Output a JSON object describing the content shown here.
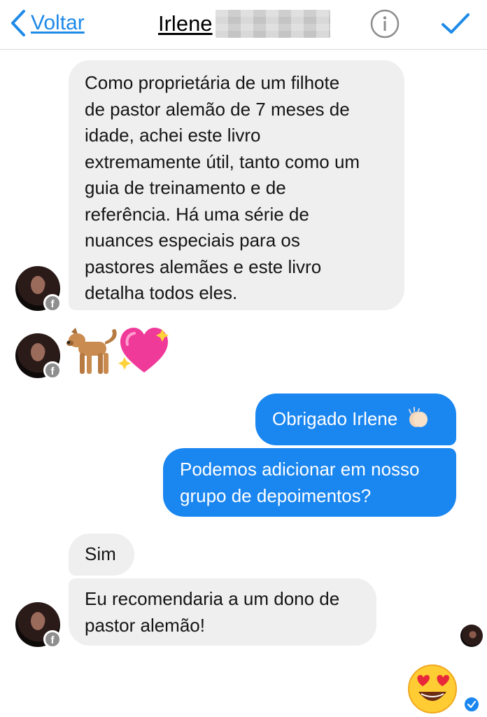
{
  "header": {
    "back_label": "Voltar",
    "contact_name": "Irlene",
    "icons": {
      "back": "chevron-left-icon",
      "info": "info-icon",
      "done": "checkmark-icon"
    }
  },
  "colors": {
    "accent": "#1E8AE8",
    "incoming_bubble": "#EFEFF0",
    "outgoing_bubble": "#1A86F0"
  },
  "messages": [
    {
      "direction": "incoming",
      "lines": [
        "Como proprietária de um filhote",
        "de pastor alemão de 7 meses de",
        "idade, achei este livro",
        "extremamente útil, tanto como um",
        "guia de treinamento e de",
        "referência. Há uma série de",
        "nuances especiais para os",
        "pastores alemães e este livro",
        "detalha todos eles."
      ]
    },
    {
      "direction": "incoming",
      "type": "emoji",
      "emojis": [
        "dog-emoji",
        "sparkling-heart-emoji"
      ]
    },
    {
      "direction": "outgoing",
      "text": "Obrigado Irlene",
      "emoji": "clapping-hands-emoji"
    },
    {
      "direction": "outgoing",
      "lines": [
        "Podemos adicionar em nosso",
        "grupo de depoimentos?"
      ]
    },
    {
      "direction": "incoming",
      "text": "Sim"
    },
    {
      "direction": "incoming",
      "lines": [
        "Eu recomendaria a um dono de",
        "pastor alemão!"
      ]
    },
    {
      "direction": "outgoing",
      "type": "emoji",
      "emojis": [
        "heart-eyes-emoji"
      ]
    }
  ]
}
